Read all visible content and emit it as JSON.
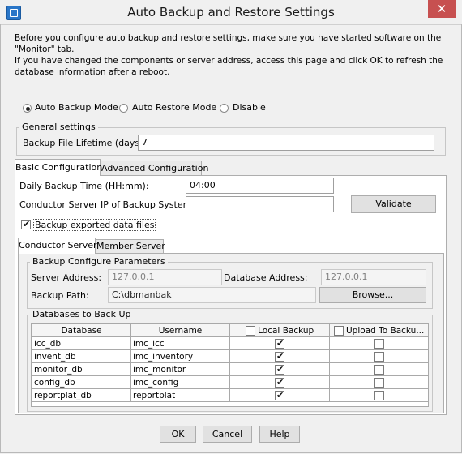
{
  "window": {
    "title": "Auto Backup and Restore Settings",
    "close_glyph": "✕",
    "icon": "app-icon"
  },
  "intro": "Before you configure auto backup and restore settings, make sure you have started software on the \"Monitor\" tab.\nIf you have changed the components or server address, access this page and click OK to refresh the database information after a reboot.",
  "mode": {
    "options": [
      "Auto Backup Mode",
      "Auto Restore Mode",
      "Disable"
    ],
    "selected": "Auto Backup Mode"
  },
  "general": {
    "legend": "General settings",
    "lifetime_label": "Backup File Lifetime (days):",
    "lifetime_value": "7"
  },
  "tabs": {
    "items": [
      "Basic Configuration",
      "Advanced Configuration"
    ],
    "active": "Basic Configuration"
  },
  "basic": {
    "daily_time_label": "Daily Backup Time (HH:mm):",
    "daily_time_value": "04:00",
    "conductor_ip_label": "Conductor Server IP of Backup System:",
    "conductor_ip_value": "",
    "validate_label": "Validate",
    "export_checkbox_label": "Backup exported data files",
    "export_checked": true
  },
  "server_tabs": {
    "items": [
      "Conductor Server",
      "Member Server"
    ],
    "active": "Conductor Server"
  },
  "params": {
    "legend": "Backup Configure Parameters",
    "server_address_label": "Server Address:",
    "server_address_value": "127.0.0.1",
    "database_address_label": "Database Address:",
    "database_address_value": "127.0.0.1",
    "backup_path_label": "Backup Path:",
    "backup_path_value": "C:\\dbmanbak",
    "browse_label": "Browse..."
  },
  "databases": {
    "legend": "Databases to Back Up",
    "columns": [
      "Database",
      "Username",
      "Local Backup",
      "Upload To Backu..."
    ],
    "header_checks": {
      "local_backup": false,
      "upload": false
    },
    "rows": [
      {
        "database": "icc_db",
        "username": "imc_icc",
        "local": true,
        "upload": false
      },
      {
        "database": "invent_db",
        "username": "imc_inventory",
        "local": true,
        "upload": false
      },
      {
        "database": "monitor_db",
        "username": "imc_monitor",
        "local": true,
        "upload": false
      },
      {
        "database": "config_db",
        "username": "imc_config",
        "local": true,
        "upload": false
      },
      {
        "database": "reportplat_db",
        "username": "reportplat",
        "local": true,
        "upload": false
      }
    ]
  },
  "footer": {
    "ok_label": "OK",
    "cancel_label": "Cancel",
    "help_label": "Help"
  }
}
